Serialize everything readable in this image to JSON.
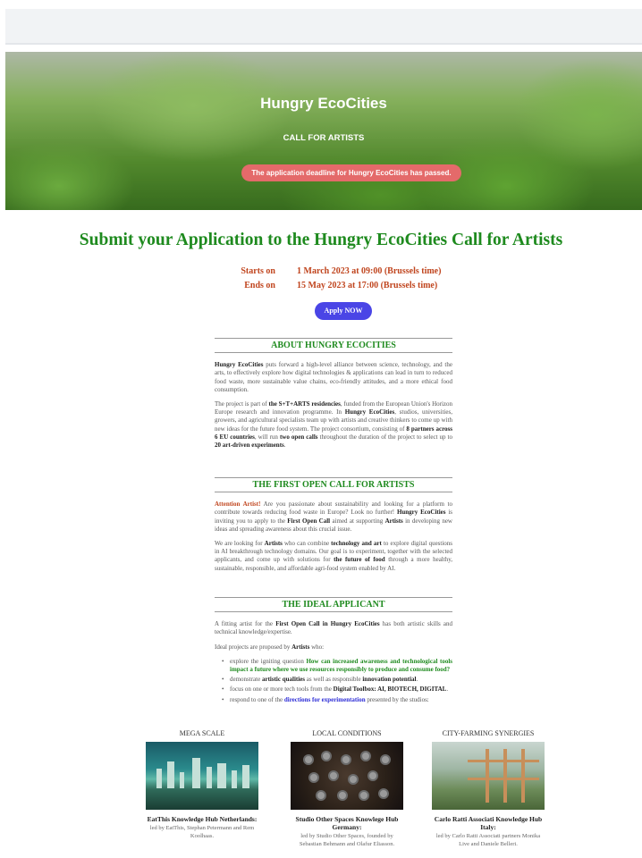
{
  "hero": {
    "title": "Hungry EcoCities",
    "subtitle": "CALL FOR ARTISTS",
    "alert": "The application deadline for Hungry EcoCities has passed."
  },
  "main_title": "Submit your Application to the Hungry EcoCities Call for Artists",
  "dates": {
    "start_label": "Starts on",
    "start_value": "1 March 2023 at 09:00 (Brussels time)",
    "end_label": "Ends on",
    "end_value": "15 May 2023 at 17:00 (Brussels time)"
  },
  "apply_label": "Apply NOW",
  "about": {
    "heading": "ABOUT HUNGRY ECOCITIES",
    "p1_b": "Hungry EcoCities",
    "p1": " puts forward a high-level alliance between science, technology, and the arts, to effectively explore how digital technologies & applications can lead in turn to reduced food waste, more sustainable value chains, eco-friendly attitudes, and a more ethical food consumption.",
    "p2_a": "The project is part of ",
    "p2_b1": "the S+T+ARTS residencies",
    "p2_c": ", funded from the European Union's Horizon Europe research and innovation programme. In ",
    "p2_b2": "Hungry EcoCities",
    "p2_d": ", studios, universities, growers, and agricultural specialists team up with artists and creative thinkers to come up with new ideas for the future food system. The project consortium, consisting of ",
    "p2_b3": "8 partners across 6 EU countries",
    "p2_e": ", will run ",
    "p2_b4": "two open calls",
    "p2_f": " throughout the duration of the project to select up to ",
    "p2_b5": "20 art-driven experiments",
    "p2_g": "."
  },
  "first_call": {
    "heading": "THE FIRST OPEN CALL FOR ARTISTS",
    "p1_o": "Attention Artist!",
    "p1_a": " Are you passionate about sustainability and looking for a platform to contribute towards reducing food waste in Europe? Look no further! ",
    "p1_b1": "Hungry EcoCities",
    "p1_c": " is inviting you to apply to the ",
    "p1_b2": "First Open Call",
    "p1_d": " aimed at supporting ",
    "p1_b3": "Artists",
    "p1_e": " in developing new ideas and spreading awareness about this crucial issue.",
    "p2_a": "We are looking for ",
    "p2_b1": "Artists",
    "p2_c": " who can combine ",
    "p2_b2": "technology and art",
    "p2_d": " to explore digital questions in AI breakthrough technology domains. Our goal is to experiment, together with the selected applicants, and come up with solutions for ",
    "p2_b3": "the future of food",
    "p2_e": " through a more healthy, sustainable, responsible, and affordable agri-food system enabled by AI."
  },
  "ideal": {
    "heading": "THE IDEAL APPLICANT",
    "p1_a": "A fitting artist for the ",
    "p1_b": "First Open Call in Hungry EcoCities",
    "p1_c": " has both artistic skills and technical knowledge/expertise.",
    "p2_a": "Ideal projects are proposed by ",
    "p2_b": "Artists",
    "p2_c": " who:",
    "li1_a": "explore the igniting question ",
    "li1_g": "How can increased awareness and technological tools impact a future where we use resources responsibly to produce and consume food?",
    "li2_a": "demonstrate ",
    "li2_b1": "artistic qualities",
    "li2_c": " as well as responsible ",
    "li2_b2": "innovation potential",
    "li2_d": ".",
    "li3_a": "focus on one or more tech tools from the ",
    "li3_b": "Digital Toolbox: AI, BIOTECH, DIGITAL",
    "li3_c": ".",
    "li4_a": "respond to one of the ",
    "li4_link": "directions for experimentation",
    "li4_c": " presented by the studios:"
  },
  "cards": [
    {
      "category": "MEGA SCALE",
      "title": "EatThis Knowledge Hub Netherlands:",
      "sub": "led by EatThis, Stephan Petermann and Rem Koolhaas."
    },
    {
      "category": "LOCAL CONDITIONS",
      "title": "Studio Other Spaces Knowlege Hub Germany:",
      "sub": "led by Studio Other Spaces, founded by Sebastian Behmann and Olafur Eliasson."
    },
    {
      "category": "CITY-FARMING SYNERGIES",
      "title": "Carlo Ratti Associati Knowledge Hub Italy:",
      "sub": "led by Carlo Ratti Associati partners Monika Live and Daniele Belleri."
    }
  ],
  "colors": {
    "accent_green": "#1e8a1e",
    "date_orange": "#c0451e",
    "button_blue": "#4a45e6",
    "alert_red": "#e46a6a"
  }
}
